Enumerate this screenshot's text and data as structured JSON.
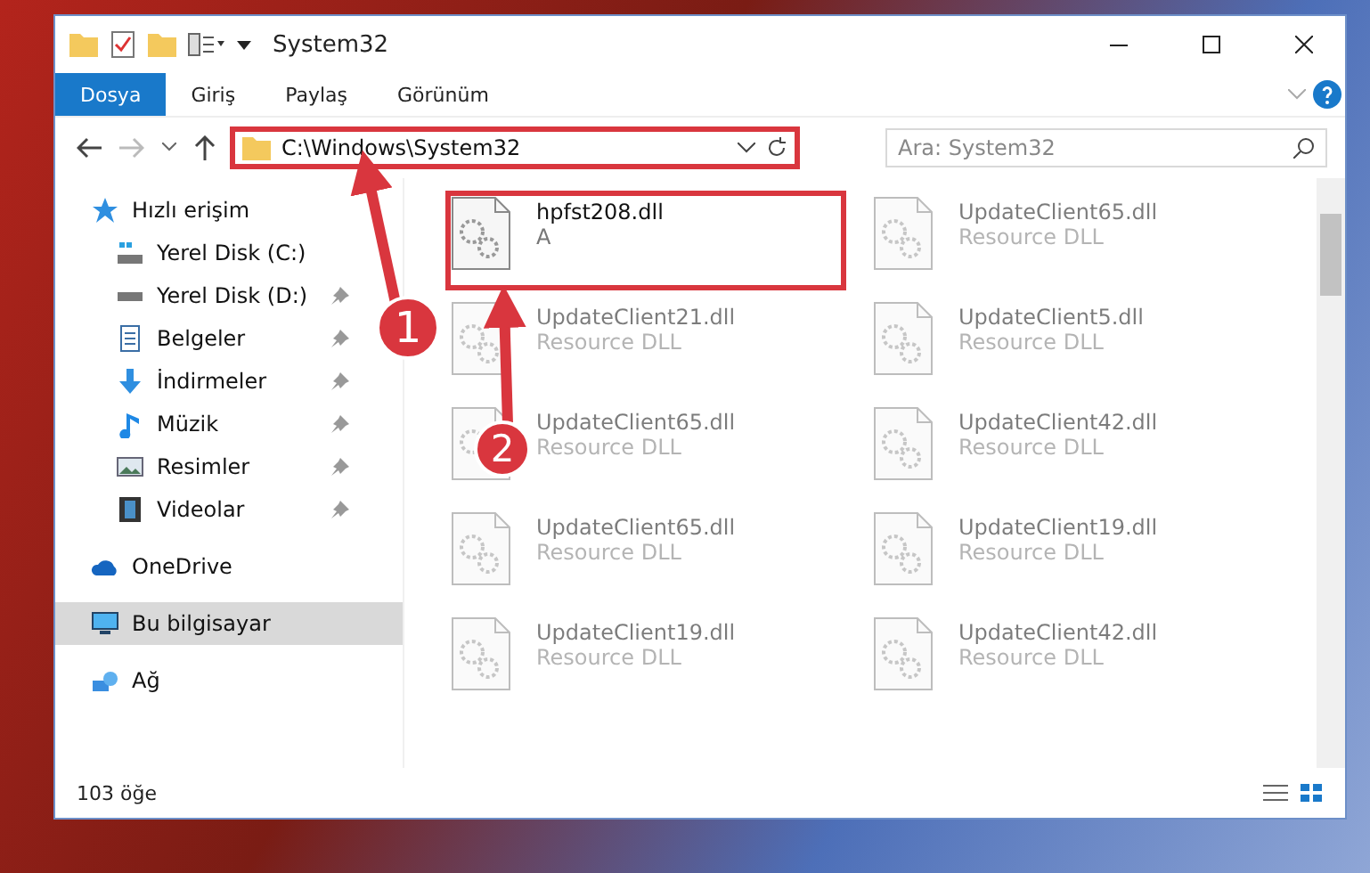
{
  "window": {
    "title": "System32"
  },
  "ribbon": {
    "tabs": [
      {
        "label": "Dosya",
        "selected": true
      },
      {
        "label": "Giriş",
        "selected": false
      },
      {
        "label": "Paylaş",
        "selected": false
      },
      {
        "label": "Görünüm",
        "selected": false
      }
    ]
  },
  "address": {
    "path": "C:\\Windows\\System32",
    "highlighted": true
  },
  "search": {
    "placeholder": "Ara: System32"
  },
  "sidebar": {
    "items": [
      {
        "label": "Hızlı erişim",
        "pinned": false,
        "selected": false,
        "children": [
          {
            "label": "Yerel Disk (C:)",
            "pinned": false,
            "selected": false
          },
          {
            "label": "Yerel Disk (D:)",
            "pinned": true,
            "selected": false
          },
          {
            "label": "Belgeler",
            "pinned": true,
            "selected": false
          },
          {
            "label": "İndirmeler",
            "pinned": true,
            "selected": false
          },
          {
            "label": "Müzik",
            "pinned": true,
            "selected": false
          },
          {
            "label": "Resimler",
            "pinned": true,
            "selected": false
          },
          {
            "label": "Videolar",
            "pinned": true,
            "selected": false
          }
        ]
      },
      {
        "label": "OneDrive",
        "pinned": false,
        "selected": false
      },
      {
        "label": "Bu bilgisayar",
        "pinned": false,
        "selected": true
      },
      {
        "label": "Ağ",
        "pinned": false,
        "selected": false
      }
    ]
  },
  "files": [
    {
      "name": "hpfst208.dll",
      "type": "A",
      "highlighted": true
    },
    {
      "name": "UpdateClient65.dll",
      "type": "Resource DLL",
      "highlighted": false
    },
    {
      "name": "UpdateClient21.dll",
      "type": "Resource DLL",
      "highlighted": false
    },
    {
      "name": "UpdateClient5.dll",
      "type": "Resource DLL",
      "highlighted": false
    },
    {
      "name": "UpdateClient65.dll",
      "type": "Resource DLL",
      "highlighted": false
    },
    {
      "name": "UpdateClient42.dll",
      "type": "Resource DLL",
      "highlighted": false
    },
    {
      "name": "UpdateClient65.dll",
      "type": "Resource DLL",
      "highlighted": false
    },
    {
      "name": "UpdateClient19.dll",
      "type": "Resource DLL",
      "highlighted": false
    },
    {
      "name": "UpdateClient19.dll",
      "type": "Resource DLL",
      "highlighted": false
    },
    {
      "name": "UpdateClient42.dll",
      "type": "Resource DLL",
      "highlighted": false
    }
  ],
  "status_bar": {
    "count": "103 öğe"
  },
  "annotations": [
    {
      "label": "1"
    },
    {
      "label": "2"
    }
  ]
}
